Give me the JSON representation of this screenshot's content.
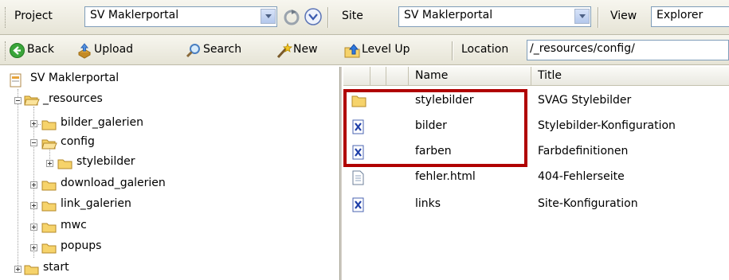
{
  "toolbar_top": {
    "project_label": "Project",
    "project_value": "SV Maklerportal",
    "site_label": "Site",
    "site_value": "SV Maklerportal",
    "view_label": "View",
    "view_value": "Explorer"
  },
  "toolbar_nav": {
    "back_label": "Back",
    "upload_label": "Upload",
    "search_label": "Search",
    "new_label": "New",
    "level_up_label": "Level Up",
    "location_label": "Location",
    "location_value": "/_resources/config/"
  },
  "tree": {
    "root": "SV Maklerportal",
    "resources": "_resources",
    "bilder_galerien": "bilder_galerien",
    "config": "config",
    "stylebilder": "stylebilder",
    "download_galerien": "download_galerien",
    "link_galerien": "link_galerien",
    "mwc": "mwc",
    "popups": "popups",
    "start": "start"
  },
  "table": {
    "columns": {
      "name": "Name",
      "title": "Title"
    },
    "rows": [
      {
        "name": "stylebilder",
        "title": "SVAG Stylebilder",
        "icon": "folder-icon"
      },
      {
        "name": "bilder",
        "title": "Stylebilder-Konfiguration",
        "icon": "xml-file-icon"
      },
      {
        "name": "farben",
        "title": "Farbdefinitionen",
        "icon": "xml-file-icon"
      },
      {
        "name": "fehler.html",
        "title": "404-Fehlerseite",
        "icon": "html-file-icon"
      },
      {
        "name": "links",
        "title": "Site-Konfiguration",
        "icon": "xml-file-icon"
      }
    ]
  },
  "colors": {
    "highlight": "#b00000",
    "toolbar": "#ece9d8",
    "input_border": "#7f9db9"
  }
}
